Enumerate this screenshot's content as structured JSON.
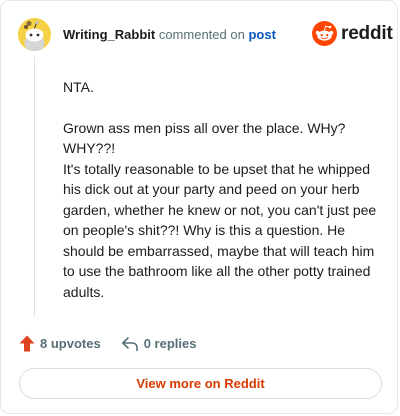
{
  "header": {
    "username": "Writing_Rabbit",
    "action_text": "commented on",
    "post_link": "post",
    "brand": "reddit"
  },
  "comment": {
    "paragraphs": [
      "NTA.",
      "Grown ass men piss all over the place. WHy? WHY??!",
      "It's totally reasonable to be upset that he whipped his dick out at your party and peed on your herb garden, whether he knew or not, you can't just pee on people's shit??! Why is this a question. He should be embarrassed, maybe that will teach him to use the bathroom like all the other potty trained adults."
    ]
  },
  "actions": {
    "upvotes": "8 upvotes",
    "replies": "0 replies",
    "view_more": "View more on Reddit"
  },
  "colors": {
    "brand_orange": "#ff4500",
    "upvote_red": "#d93a00",
    "link_blue": "#0a57c2"
  },
  "icons": [
    "snoo-avatar-icon",
    "reddit-logo-icon",
    "upvote-arrow-icon",
    "reply-icon"
  ]
}
